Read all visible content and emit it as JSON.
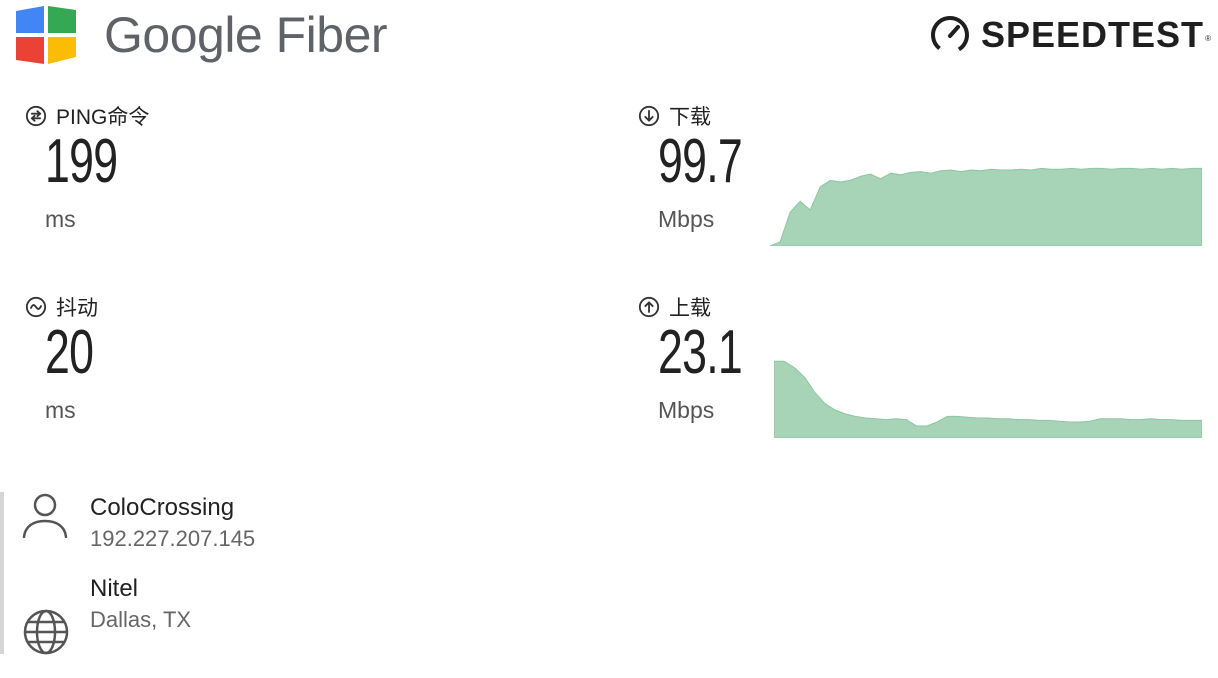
{
  "header": {
    "brand_name": "Google Fiber",
    "speedtest_name": "SPEEDTEST",
    "speedtest_registered": "®",
    "brand_icon": "google-fiber-logo",
    "speedtest_icon": "speedometer-icon",
    "colors": {
      "blue": "#4285F4",
      "green": "#34A853",
      "red": "#EA4335",
      "yellow": "#FBBC05",
      "wordmark": "#5f6368"
    }
  },
  "metrics": {
    "ping": {
      "label": "PING命令",
      "value": "199",
      "unit": "ms",
      "icon": "ping-icon"
    },
    "jitter": {
      "label": "抖动",
      "value": "20",
      "unit": "ms",
      "icon": "jitter-icon"
    },
    "download": {
      "label": "下载",
      "value": "99.7",
      "unit": "Mbps",
      "icon": "download-arrow-icon"
    },
    "upload": {
      "label": "上载",
      "value": "23.1",
      "unit": "Mbps",
      "icon": "upload-arrow-icon"
    }
  },
  "graphs": {
    "download": {
      "color": "#a7d3b6",
      "stroke": "#8cc7a0",
      "points": [
        0.0,
        0.05,
        0.42,
        0.56,
        0.45,
        0.74,
        0.82,
        0.8,
        0.82,
        0.87,
        0.9,
        0.84,
        0.91,
        0.89,
        0.92,
        0.93,
        0.91,
        0.94,
        0.95,
        0.93,
        0.95,
        0.94,
        0.96,
        0.95,
        0.95,
        0.96,
        0.95,
        0.97,
        0.96,
        0.96,
        0.97,
        0.96,
        0.97,
        0.97,
        0.96,
        0.97,
        0.97,
        0.96,
        0.97,
        0.96,
        0.97,
        0.96,
        0.97,
        0.97
      ]
    },
    "upload": {
      "color": "#a7d3b6",
      "stroke": "#8cc7a0",
      "points": [
        0.96,
        0.96,
        0.88,
        0.76,
        0.57,
        0.43,
        0.35,
        0.3,
        0.27,
        0.25,
        0.24,
        0.23,
        0.24,
        0.23,
        0.15,
        0.15,
        0.2,
        0.27,
        0.27,
        0.26,
        0.25,
        0.25,
        0.24,
        0.24,
        0.23,
        0.23,
        0.22,
        0.22,
        0.21,
        0.2,
        0.2,
        0.21,
        0.24,
        0.24,
        0.24,
        0.23,
        0.23,
        0.24,
        0.23,
        0.23,
        0.22,
        0.22,
        0.22
      ]
    }
  },
  "server": {
    "isp_icon": "user-icon",
    "location_icon": "globe-icon",
    "isp_name": "ColoCrossing",
    "isp_ip": "192.227.207.145",
    "host_name": "Nitel",
    "host_location": "Dallas, TX"
  }
}
